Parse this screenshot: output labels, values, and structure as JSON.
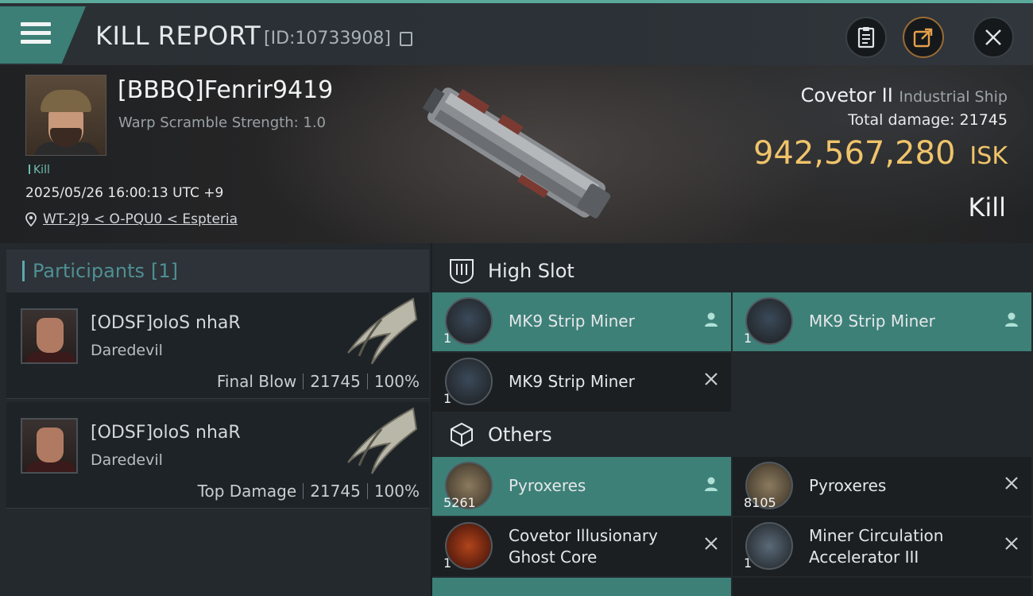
{
  "header": {
    "title": "KILL REPORT",
    "report_id": "[ID:10733908]",
    "menu_icon": "hamburger-icon",
    "buttons": [
      {
        "name": "clipboard-button",
        "icon": "clipboard-icon"
      },
      {
        "name": "share-button",
        "icon": "share-icon"
      },
      {
        "name": "close-button",
        "icon": "close-icon"
      }
    ]
  },
  "victim": {
    "name": "[BBBQ]Fenrir9419",
    "warp_scramble": "Warp Scramble Strength: 1.0",
    "kill_tag": "Kill",
    "datetime": "2025/05/26 16:00:13 UTC +9",
    "location": "WT-2J9 < O-PQU0 < Espteria",
    "ship_name": "Covetor II",
    "ship_class": "Industrial Ship",
    "total_damage_label": "Total damage:",
    "total_damage": "21745",
    "isk_value": "942,567,280",
    "isk_unit": "ISK",
    "outcome": "Kill"
  },
  "participants": {
    "label": "Participants",
    "count": "[1]",
    "items": [
      {
        "name": "[ODSF]oloS nhaR",
        "ship": "Daredevil",
        "role": "Final Blow",
        "damage": "21745",
        "percent": "100%"
      },
      {
        "name": "[ODSF]oloS nhaR",
        "ship": "Daredevil",
        "role": "Top Damage",
        "damage": "21745",
        "percent": "100%"
      }
    ]
  },
  "high_slot": {
    "label": "High Slot",
    "items": [
      {
        "name": "MK9 Strip Miner",
        "qty": "1",
        "status": "person-icon"
      },
      {
        "name": "MK9 Strip Miner",
        "qty": "1",
        "status": "person-icon"
      },
      {
        "name": "MK9 Strip Miner",
        "qty": "1",
        "status": "x-icon"
      }
    ]
  },
  "others": {
    "label": "Others",
    "items": [
      {
        "name": "Pyroxeres",
        "qty": "5261",
        "status": "person-icon"
      },
      {
        "name": "Pyroxeres",
        "qty": "8105",
        "status": "x-icon"
      },
      {
        "name_line1": "Covetor Illusionary",
        "name_line2": "Ghost Core",
        "qty": "1",
        "status": "x-icon"
      },
      {
        "name_line1": "Miner Circulation",
        "name_line2": "Accelerator III",
        "qty": "1",
        "status": "x-icon"
      }
    ]
  },
  "colors": {
    "accent_teal": "#3d8078",
    "isk_gold": "#f0c46a",
    "background": "#1b1f23"
  }
}
